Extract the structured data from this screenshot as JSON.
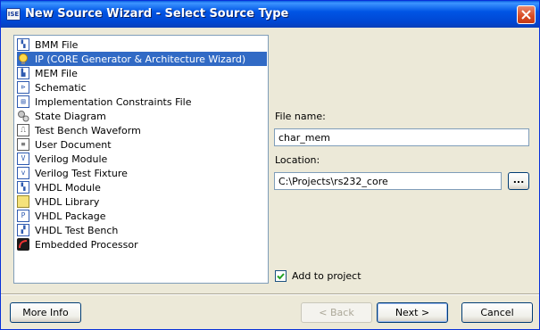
{
  "window": {
    "title": "New Source Wizard - Select Source Type",
    "app_icon": "ise-icon",
    "close_icon": "close-icon"
  },
  "source_list": {
    "items": [
      {
        "label": "BMM File",
        "icon": "bmm-file-icon",
        "selected": false
      },
      {
        "label": "IP (CORE Generator & Architecture Wizard)",
        "icon": "ip-core-bulb-icon",
        "selected": true
      },
      {
        "label": "MEM File",
        "icon": "mem-file-icon",
        "selected": false
      },
      {
        "label": "Schematic",
        "icon": "schematic-icon",
        "selected": false
      },
      {
        "label": "Implementation Constraints File",
        "icon": "constraints-file-icon",
        "selected": false
      },
      {
        "label": "State Diagram",
        "icon": "state-diagram-icon",
        "selected": false
      },
      {
        "label": "Test Bench Waveform",
        "icon": "waveform-icon",
        "selected": false
      },
      {
        "label": "User Document",
        "icon": "document-icon",
        "selected": false
      },
      {
        "label": "Verilog Module",
        "icon": "verilog-module-icon",
        "selected": false
      },
      {
        "label": "Verilog Test Fixture",
        "icon": "verilog-fixture-icon",
        "selected": false
      },
      {
        "label": "VHDL Module",
        "icon": "vhdl-module-icon",
        "selected": false
      },
      {
        "label": "VHDL Library",
        "icon": "vhdl-library-icon",
        "selected": false
      },
      {
        "label": "VHDL Package",
        "icon": "vhdl-package-icon",
        "selected": false
      },
      {
        "label": "VHDL Test Bench",
        "icon": "vhdl-testbench-icon",
        "selected": false
      },
      {
        "label": "Embedded Processor",
        "icon": "processor-icon",
        "selected": false
      }
    ]
  },
  "form": {
    "file_name_label": "File name:",
    "file_name_value": "char_mem",
    "location_label": "Location:",
    "location_value": "C:\\Projects\\rs232_core",
    "browse_label": "...",
    "add_to_project_label": "Add to project",
    "add_to_project_checked": true
  },
  "buttons": {
    "more_info": "More Info",
    "back": "< Back",
    "next": "Next >",
    "cancel": "Cancel"
  },
  "colors": {
    "selection": "#316ac5",
    "titlebar": "#0055e5",
    "dialog_bg": "#ece9d8"
  }
}
